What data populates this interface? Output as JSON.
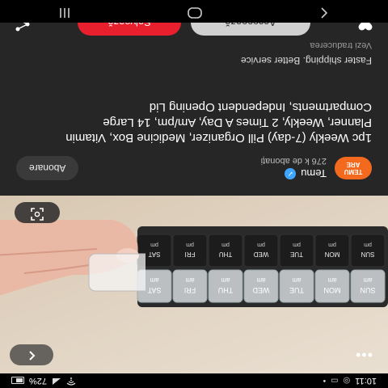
{
  "status_bar": {
    "time": "10:11",
    "battery": "72%",
    "icons": [
      "whatsapp-icon",
      "messages-icon",
      "alarm-icon",
      "wifi-icon",
      "signal-icon",
      "battery-icon"
    ]
  },
  "photo": {
    "back_icon": "chevron-left-icon",
    "more_icon": "more-icon",
    "more_label": "•••",
    "lens_icon": "lens-scan-icon",
    "compartments": {
      "top_row": [
        "SUN",
        "MON",
        "TUE",
        "WED",
        "THU",
        "FRI",
        "SAT"
      ],
      "top_sub": [
        "am",
        "am",
        "am",
        "am",
        "am",
        "am",
        "am"
      ],
      "bottom_row": [
        "SUN",
        "MON",
        "TUE",
        "WED",
        "THU",
        "FRI",
        "SAT"
      ],
      "bottom_sub": [
        "pm",
        "pm",
        "pm",
        "pm",
        "pm",
        "pm",
        "pm"
      ]
    }
  },
  "channel": {
    "name": "Temu",
    "subscribers": "276 k de abonați",
    "avatar_line1": "TEMU",
    "avatar_line2": "ARE",
    "subscribe_label": "Abonare"
  },
  "title": "1pc Weekly (7-day) Pill Organizer, Medicine Box, Vitamin Planner, Weekly, 2 Times A Day, Am/pm, 14 Large Compartments, Independent Opening Lid",
  "description": "Faster shipping. Better service",
  "translate_label": "Vezi traducerea",
  "actions": {
    "access_label": "Accesează",
    "save_label": "Salvează",
    "heart_icon": "heart-icon",
    "share_icon": "share-icon"
  },
  "nav": {
    "recents_icon": "recents-icon",
    "home_icon": "home-icon",
    "back_icon": "back-icon"
  },
  "colors": {
    "panel_bg": "#262626",
    "save_red": "#e8202e",
    "temu_orange": "#f36a1f",
    "verified_blue": "#3ea6ff"
  }
}
